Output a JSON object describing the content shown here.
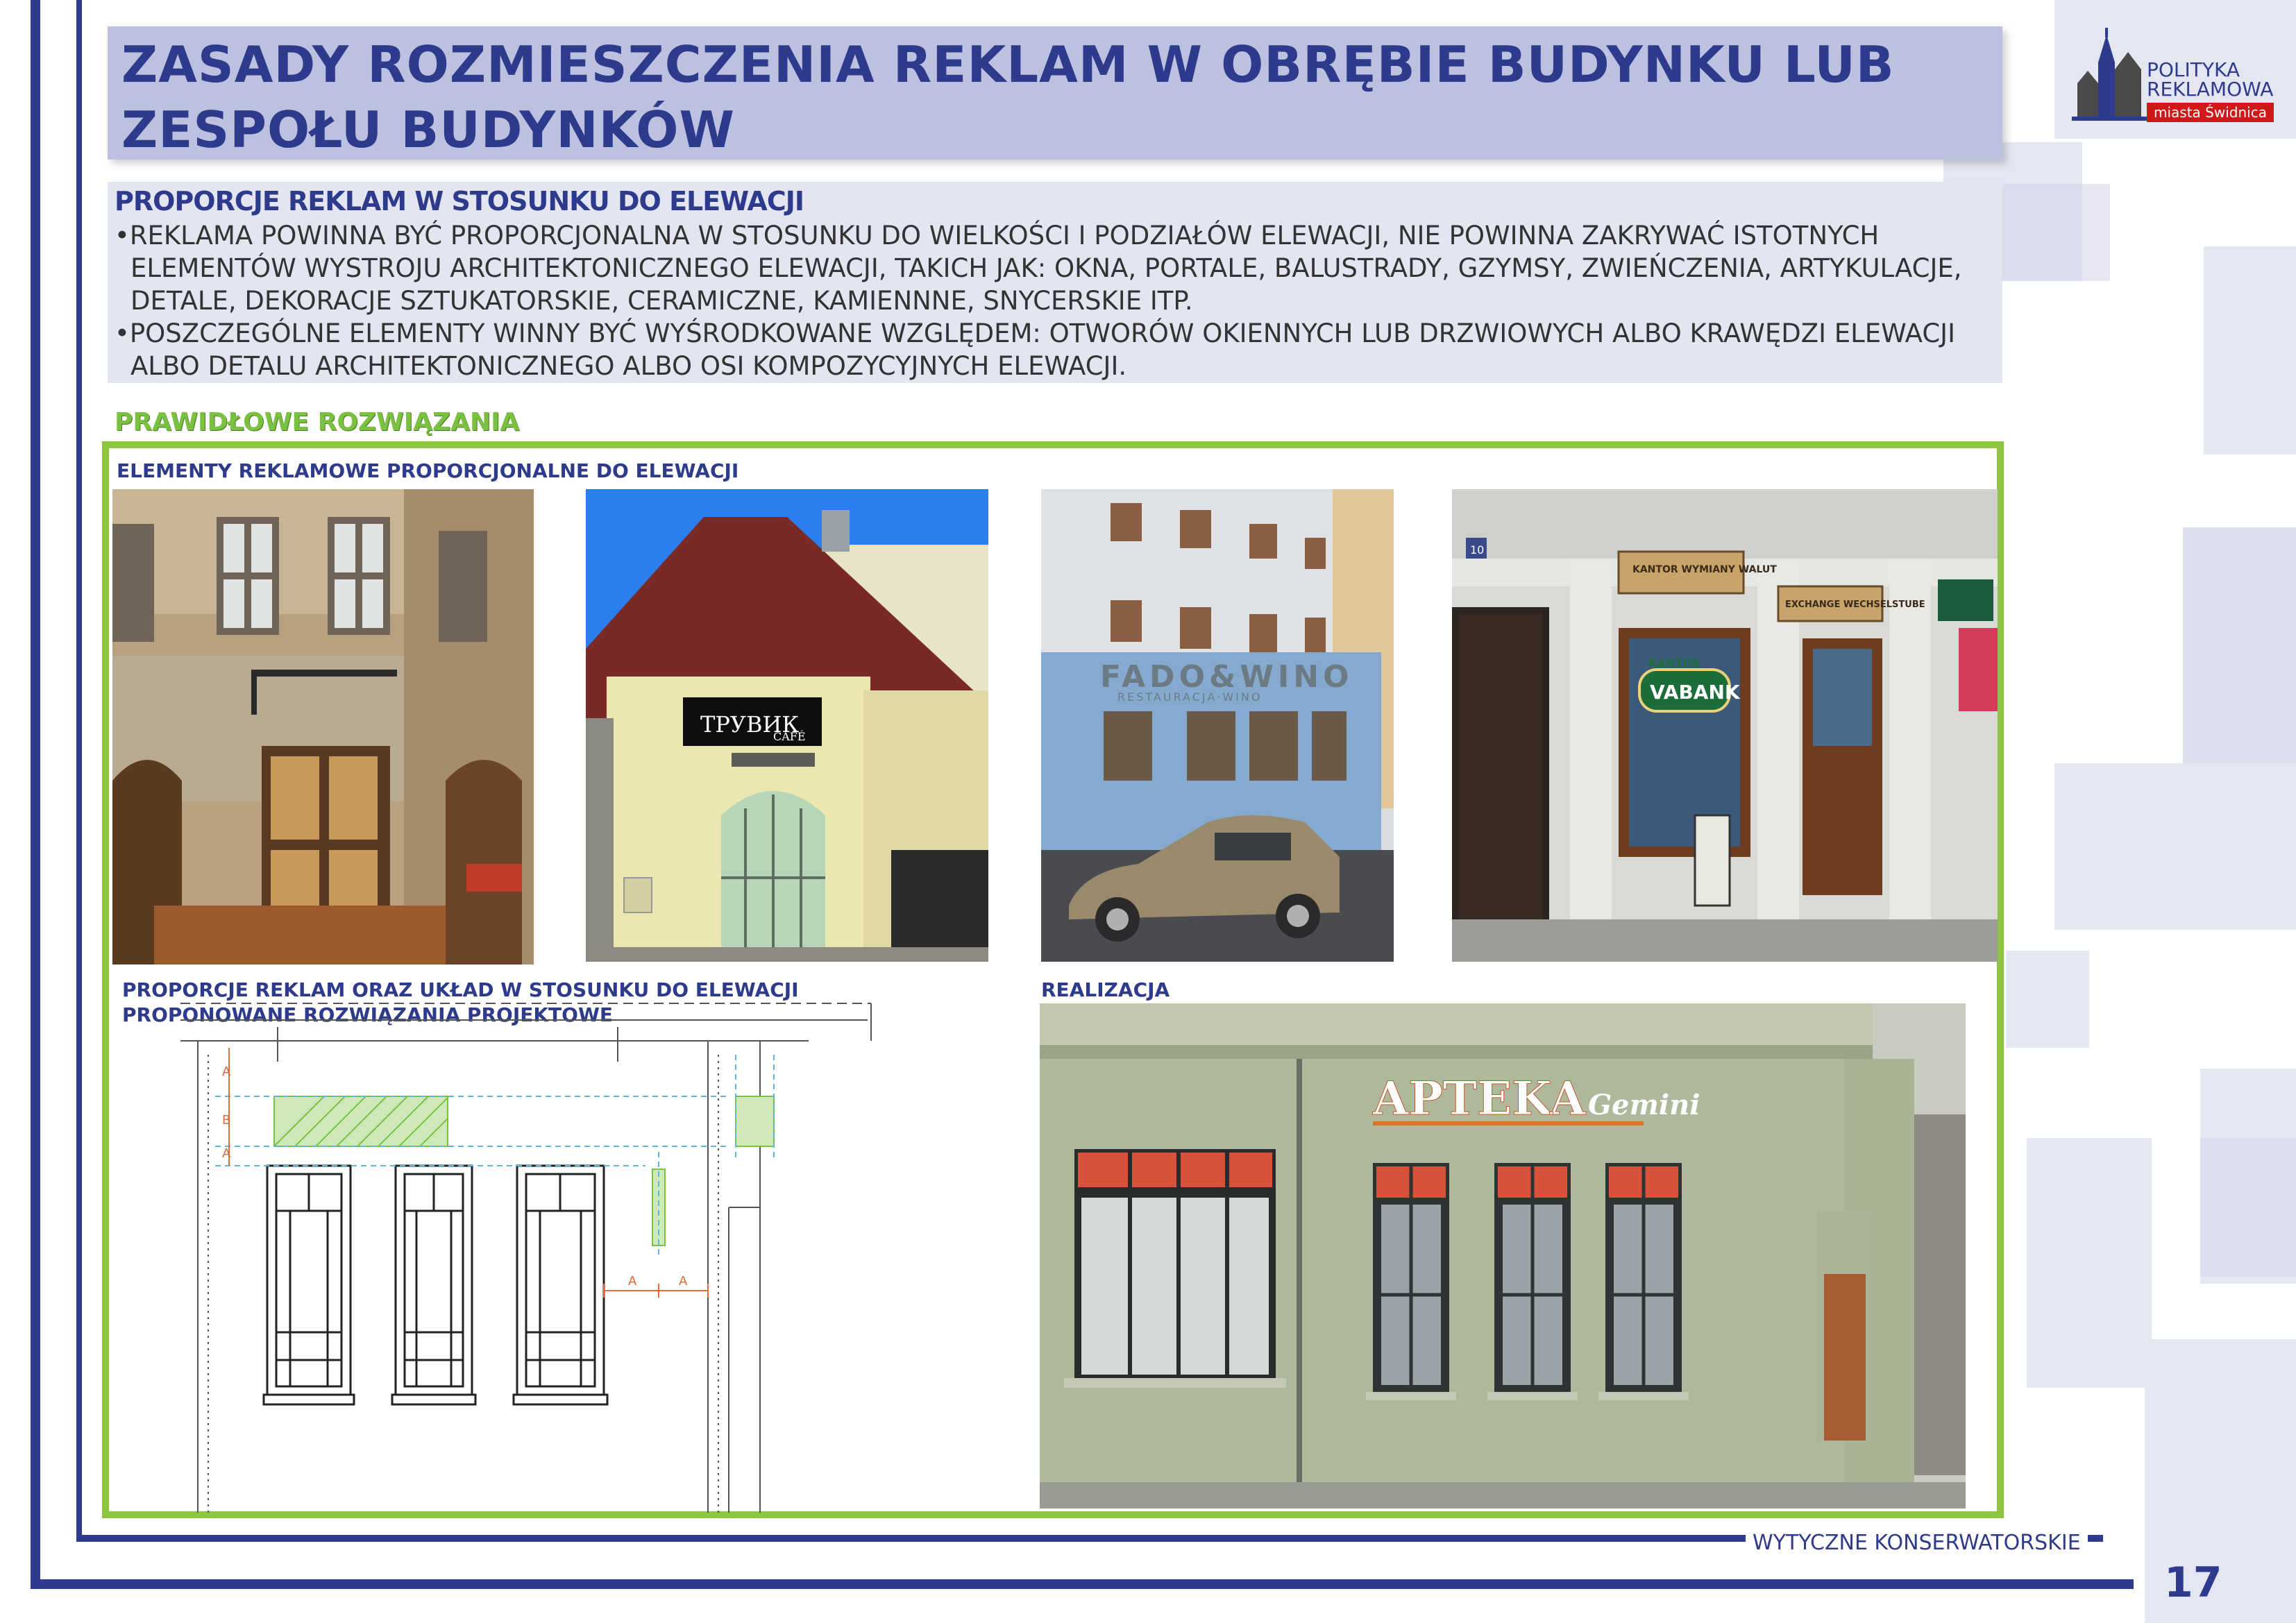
{
  "title": "ZASADY ROZMIESZCZENIA REKLAM W OBRĘBIE BUDYNKU LUB ZESPOŁU BUDYNKÓW",
  "logo": {
    "line1": "POLITYKA",
    "line2": "REKLAMOWA",
    "line3": "miasta Świdnica"
  },
  "section": {
    "heading": "PROPORCJE REKLAM W STOSUNKU DO ELEWACJI",
    "bullet1_line1": "•REKLAMA POWINNA BYĆ PROPORCJONALNA W STOSUNKU DO WIELKOŚCI I PODZIAŁÓW ELEWACJI, NIE POWINNA ZAKRYWAĆ ISTOTNYCH",
    "bullet1_line2": "ELEMENTÓW WYSTROJU ARCHITEKTONICZNEGO ELEWACJI, TAKICH JAK: OKNA, PORTALE, BALUSTRADY, GZYMSY, ZWIEŃCZENIA, ARTYKULACJE,",
    "bullet1_line3": "DETALE, DEKORACJE SZTUKATORSKIE, CERAMICZNE, KAMIENNNE, SNYCERSKIE ITP.",
    "bullet2_line1": "•POSZCZEGÓLNE ELEMENTY WINNY BYĆ WYŚRODKOWANE WZGLĘDEM: OTWORÓW OKIENNYCH LUB DRZWIOWYCH ALBO KRAWĘDZI ELEWACJI",
    "bullet2_line2": "ALBO DETALU ARCHITEKTONICZNEGO ALBO OSI KOMPOZYCYJNYCH ELEWACJI."
  },
  "correct": {
    "heading": "PRAWIDŁOWE ROZWIĄZANIA",
    "label_top": "ELEMENTY REKLAMOWE PROPORCJONALNE DO ELEWACJI",
    "label_drawing_1": "PROPORCJE REKLAM ORAZ UKŁAD W STOSUNKU DO ELEWACJI",
    "label_drawing_2": "PROPONOWANE ROZWIĄZANIA PROJEKTOWE",
    "label_real": "REALIZACJA"
  },
  "photos": {
    "cafe_sign_1": "ТРУВИК",
    "cafe_sign_2": "CAFÉ",
    "fado_sign": "FADO&WINO",
    "fado_sub": "RESTAURACJA·WINO",
    "kantor_top": "KANTOR",
    "kantor_name": "VABANK",
    "kantor_plaque_1": "KANTOR WYMIANY WALUT",
    "kantor_plaque_2": "EXCHANGE WECHSELSTUBE",
    "house_number": "10",
    "apteka_main": "APTEKA",
    "apteka_script": "Gemini"
  },
  "drawing": {
    "dim_a": "A",
    "dim_b": "B"
  },
  "footer": {
    "label": "WYTYCZNE KONSERWATORSKIE",
    "page": "17"
  },
  "colors": {
    "navy": "#2e3a8c",
    "green": "#8cc63f",
    "title_bg": "#bcc1df"
  }
}
